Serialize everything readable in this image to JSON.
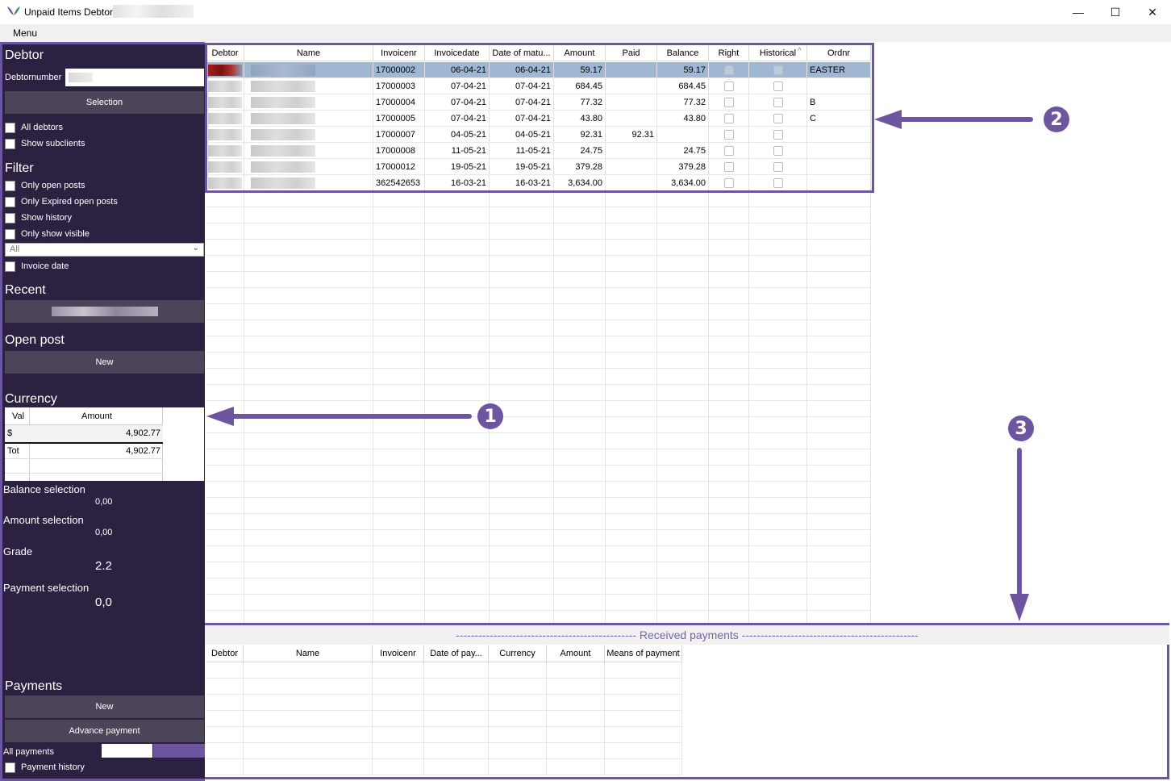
{
  "window": {
    "title": "Unpaid Items Debtor",
    "controls": {
      "minimize": "—",
      "maximize": "☐",
      "close": "✕"
    }
  },
  "menu": {
    "label": "Menu"
  },
  "sidebar": {
    "debtor_heading": "Debtor",
    "debtornumber_label": "Debtornumber",
    "selection_button": "Selection",
    "all_debtors": "All debtors",
    "show_subclients": "Show subclients",
    "filter_heading": "Filter",
    "only_open_posts": "Only open posts",
    "only_expired": "Only Expired open posts",
    "show_history": "Show history",
    "only_visible": "Only show visible",
    "dropdown_value": "All",
    "invoice_date": "Invoice date",
    "recent_heading": "Recent",
    "open_post_heading": "Open post",
    "open_post_new": "New",
    "currency_heading": "Currency",
    "currency_table": {
      "col_val": "Val",
      "col_amount": "Amount",
      "rows": [
        {
          "val": "$",
          "amount": "4,902.77"
        },
        {
          "val": "Tot",
          "amount": "4,902.77"
        }
      ]
    },
    "balance_selection_label": "Balance selection",
    "balance_selection_value": "0,00",
    "amount_selection_label": "Amount selection",
    "amount_selection_value": "0,00",
    "grade_label": "Grade",
    "grade_value": "2.2",
    "payment_selection_label": "Payment selection",
    "payment_selection_value": "0,0",
    "payments_heading": "Payments",
    "payments_new": "New",
    "advance_payment": "Advance payment",
    "all_payments": "All payments",
    "payment_history": "Payment history"
  },
  "grid": {
    "columns": [
      "Debtor",
      "Name",
      "Invoicenr",
      "Invoicedate",
      "Date of matu...",
      "Amount",
      "Paid",
      "Balance",
      "Right",
      "Historical",
      "Ordnr"
    ],
    "rows": [
      {
        "invoicenr": "17000002",
        "invoicedate": "06-04-21",
        "maturity": "06-04-21",
        "amount": "59.17",
        "paid": "",
        "balance": "59.17",
        "ordnr": "EASTER"
      },
      {
        "invoicenr": "17000003",
        "invoicedate": "07-04-21",
        "maturity": "07-04-21",
        "amount": "684.45",
        "paid": "",
        "balance": "684.45",
        "ordnr": ""
      },
      {
        "invoicenr": "17000004",
        "invoicedate": "07-04-21",
        "maturity": "07-04-21",
        "amount": "77.32",
        "paid": "",
        "balance": "77.32",
        "ordnr": "B"
      },
      {
        "invoicenr": "17000005",
        "invoicedate": "07-04-21",
        "maturity": "07-04-21",
        "amount": "43.80",
        "paid": "",
        "balance": "43.80",
        "ordnr": "C"
      },
      {
        "invoicenr": "17000007",
        "invoicedate": "04-05-21",
        "maturity": "04-05-21",
        "amount": "92.31",
        "paid": "92.31",
        "balance": "",
        "ordnr": ""
      },
      {
        "invoicenr": "17000008",
        "invoicedate": "11-05-21",
        "maturity": "11-05-21",
        "amount": "24.75",
        "paid": "",
        "balance": "24.75",
        "ordnr": ""
      },
      {
        "invoicenr": "17000012",
        "invoicedate": "19-05-21",
        "maturity": "19-05-21",
        "amount": "379.28",
        "paid": "",
        "balance": "379.28",
        "ordnr": ""
      },
      {
        "invoicenr": "362542653",
        "invoicedate": "16-03-21",
        "maturity": "16-03-21",
        "amount": "3,634.00",
        "paid": "",
        "balance": "3,634.00",
        "ordnr": ""
      }
    ]
  },
  "payments": {
    "title": "------------------------------------------------ Received payments -----------------------------------------------",
    "columns": [
      "Debtor",
      "Name",
      "Invoicenr",
      "Date of pay...",
      "Currency",
      "Amount",
      "Means of payment"
    ]
  },
  "callouts": {
    "one": "1",
    "two": "2",
    "three": "3"
  },
  "colors": {
    "accent": "#6e55a0",
    "sidebar_bg": "#2c2140",
    "button_bg": "#4c4458",
    "selected_row": "#9fb7d2"
  }
}
